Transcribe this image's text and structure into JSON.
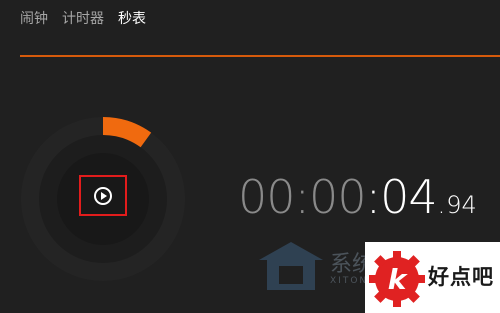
{
  "tabs": [
    {
      "label": "闹钟",
      "active": false
    },
    {
      "label": "计时器",
      "active": false
    },
    {
      "label": "秒表",
      "active": true
    }
  ],
  "accent_color": "#f06a0f",
  "progress_fraction": 0.1,
  "stopwatch": {
    "hours": "00",
    "sep1": ":",
    "minutes": "00",
    "sep2": ":",
    "seconds": "04",
    "dot": ".",
    "hundredths": "94"
  },
  "play_icon": "play-circle-icon",
  "watermarks": {
    "site1_text": "系统",
    "site1_sub": "XITON",
    "site2_text": "好点吧",
    "site2_letter": "k"
  }
}
